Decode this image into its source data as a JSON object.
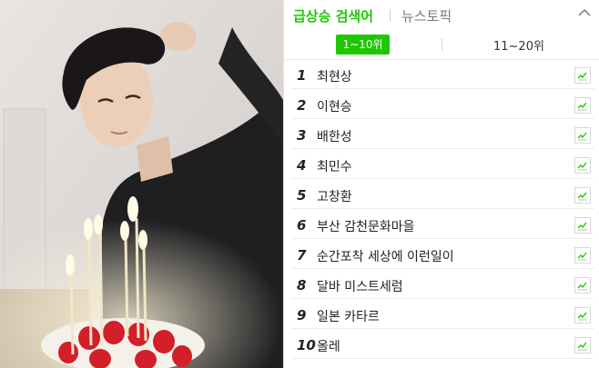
{
  "header": {
    "active_tab": "급상승 검색어",
    "other_tab": "뉴스토픽"
  },
  "ranges": {
    "active": "1~10위",
    "next": "11~20위"
  },
  "items": [
    {
      "rank": "1",
      "keyword": "최현상"
    },
    {
      "rank": "2",
      "keyword": "이현승"
    },
    {
      "rank": "3",
      "keyword": "배한성"
    },
    {
      "rank": "4",
      "keyword": "최민수"
    },
    {
      "rank": "5",
      "keyword": "고창환"
    },
    {
      "rank": "6",
      "keyword": "부산 감천문화마을"
    },
    {
      "rank": "7",
      "keyword": "순간포착 세상에 이런일이"
    },
    {
      "rank": "8",
      "keyword": "달바 미스트세럼"
    },
    {
      "rank": "9",
      "keyword": "일본 카타르"
    },
    {
      "rank": "10",
      "keyword": "올레"
    }
  ],
  "colors": {
    "accent": "#1ec800"
  }
}
